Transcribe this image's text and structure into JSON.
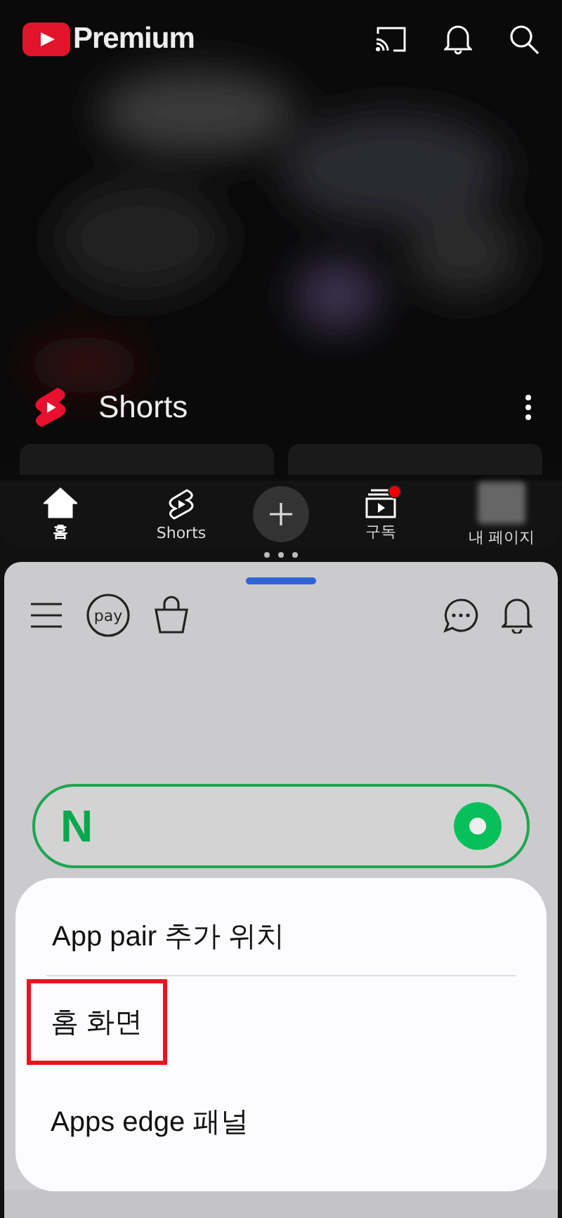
{
  "youtube": {
    "logo_text": "Premium",
    "shelf_title": "Shorts",
    "nav": [
      {
        "kind": "home",
        "label": "홈",
        "selected": true
      },
      {
        "kind": "shorts",
        "label": "Shorts",
        "selected": false
      },
      {
        "kind": "create",
        "selected": false
      },
      {
        "kind": "subscriptions",
        "label": "구독",
        "selected": false,
        "badge": true
      },
      {
        "kind": "profile",
        "label": "내 페이지",
        "selected": false
      }
    ]
  },
  "naver": {
    "logo_text": "N",
    "pay_text": "pay"
  },
  "sheet": {
    "title": "App pair 추가 위치",
    "options": [
      {
        "label": "홈 화면",
        "highlighted": true
      },
      {
        "label": "Apps edge 패널",
        "highlighted": false
      }
    ]
  }
}
